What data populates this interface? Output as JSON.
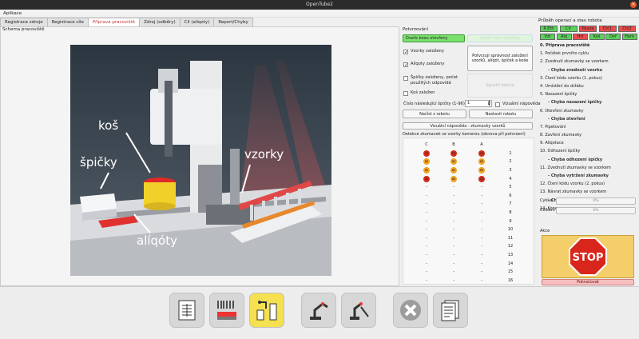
{
  "window": {
    "title": "OpenTube2"
  },
  "menu": {
    "items": [
      "Aplikace"
    ]
  },
  "tabs": [
    {
      "label": "Registrace zdroje",
      "active": false
    },
    {
      "label": "Registrace cíle",
      "active": false
    },
    {
      "label": "Příprava pracoviště",
      "active": true
    },
    {
      "label": "Zdroj (odběry)",
      "active": false
    },
    {
      "label": "Cíl (alíqoty)",
      "active": false
    },
    {
      "label": "Report/Chyby",
      "active": false
    }
  ],
  "scheme": {
    "title": "Schema pracoviště",
    "labels": {
      "kos": "koš",
      "spicky": "špičky",
      "vzorky": "vzorky",
      "aliqoty": "alíqóty"
    }
  },
  "confirm": {
    "title": "Potvrzování",
    "box_button": "Dveře boxu otevřeny",
    "box_status": "Dveře boxu zavřeny",
    "checks": [
      {
        "label": "Vzorky založeny",
        "checked": true
      },
      {
        "label": "Alíqoty založeny",
        "checked": true
      },
      {
        "label": "Špičky založeny, počet použitých odpovídá",
        "checked": false
      },
      {
        "label": "Koš založen",
        "checked": false
      }
    ],
    "confirm_button": "Potvrzuji správnost založení vzorků, alíqot, špiček a koše",
    "start_button": "Spustit robota",
    "next_tip_label": "Číslo následující špičky (1-96):",
    "next_tip_value": "1",
    "help_checkbox": "Vizuální nápověda",
    "load_button": "Načíst z robotu",
    "set_button": "Nastavit robotu",
    "visual_help_button": "Vizuální nápověda - zkumavky vzorků"
  },
  "detection": {
    "title": "Detekce zkumavek se vzorky kamerou (obnova při potvrzení)",
    "columns": [
      "C",
      "B",
      "A"
    ],
    "colors": {
      "red": "#d42a1a",
      "orange": "#f2a21b"
    },
    "rows": [
      {
        "n": "1",
        "cells": [
          {
            "c": "red",
            "t": "25"
          },
          {
            "c": "red",
            "t": "25"
          },
          {
            "c": "red",
            "t": "25"
          }
        ]
      },
      {
        "n": "2",
        "cells": [
          {
            "c": "orange",
            "t": "60"
          },
          {
            "c": "orange",
            "t": "60"
          },
          {
            "c": "orange",
            "t": "60"
          }
        ]
      },
      {
        "n": "3",
        "cells": [
          {
            "c": "orange",
            "t": "60"
          },
          {
            "c": "orange",
            "t": "60"
          },
          {
            "c": "orange",
            "t": "60"
          }
        ]
      },
      {
        "n": "4",
        "cells": [
          {
            "c": "red",
            "t": "25"
          },
          {
            "c": "orange",
            "t": "60"
          },
          {
            "c": "red",
            "t": "25"
          }
        ]
      },
      {
        "n": "5",
        "cells": [
          {
            "t": "-"
          },
          {
            "t": "-"
          },
          {
            "t": "-"
          }
        ]
      },
      {
        "n": "6",
        "cells": [
          {
            "t": "-"
          },
          {
            "t": "-"
          },
          {
            "t": "-"
          }
        ]
      },
      {
        "n": "7",
        "cells": [
          {
            "t": "-"
          },
          {
            "t": "-"
          },
          {
            "t": "-"
          }
        ]
      },
      {
        "n": "8",
        "cells": [
          {
            "t": "-"
          },
          {
            "t": "-"
          },
          {
            "t": "-"
          }
        ]
      },
      {
        "n": "9",
        "cells": [
          {
            "t": "-"
          },
          {
            "t": "-"
          },
          {
            "t": "-"
          }
        ]
      },
      {
        "n": "10",
        "cells": [
          {
            "t": "-"
          },
          {
            "t": "-"
          },
          {
            "t": "-"
          }
        ]
      },
      {
        "n": "11",
        "cells": [
          {
            "t": "-"
          },
          {
            "t": "-"
          },
          {
            "t": "-"
          }
        ]
      },
      {
        "n": "12",
        "cells": [
          {
            "t": "-"
          },
          {
            "t": "-"
          },
          {
            "t": "-"
          }
        ]
      },
      {
        "n": "13",
        "cells": [
          {
            "t": "-"
          },
          {
            "t": "-"
          },
          {
            "t": "-"
          }
        ]
      },
      {
        "n": "14",
        "cells": [
          {
            "t": "-"
          },
          {
            "t": "-"
          },
          {
            "t": "-"
          }
        ]
      },
      {
        "n": "15",
        "cells": [
          {
            "t": "-"
          },
          {
            "t": "-"
          },
          {
            "t": "-"
          }
        ]
      },
      {
        "n": "16",
        "cells": [
          {
            "t": "-"
          },
          {
            "t": "-"
          },
          {
            "t": "-"
          }
        ]
      }
    ]
  },
  "status": {
    "title": "Průběh operací a stav robota",
    "row1": [
      {
        "label": "R.Eth",
        "color": "#5ad25a"
      },
      {
        "label": "CV",
        "color": "#5ad25a"
      },
      {
        "label": "Pauza",
        "color": "#ee4b4b"
      },
      {
        "label": "Čtč1",
        "color": "#ee4b4b"
      },
      {
        "label": "Čtč2",
        "color": "#ee4b4b"
      }
    ],
    "row2": [
      {
        "label": "Vzt",
        "color": "#5ad25a"
      },
      {
        "label": "Alq",
        "color": "#5ad25a"
      },
      {
        "label": "Hrt",
        "color": "#ee4b4b"
      },
      {
        "label": "Koš",
        "color": "#5ad25a"
      },
      {
        "label": "Dvř",
        "color": "#5ad25a"
      },
      {
        "label": "Hom",
        "color": "#5ad25a"
      }
    ],
    "steps": [
      {
        "text": "0. Příprava pracoviště",
        "kind": "main"
      },
      {
        "text": "1. Počátek prvního cyklu",
        "kind": "step"
      },
      {
        "text": "2. Zvednutí zkumavky se vzorkem",
        "kind": "step"
      },
      {
        "text": "- Chyba zvednutí vzorku",
        "kind": "sub"
      },
      {
        "text": "3. Čtení kódu vzorku (1. pokus)",
        "kind": "step"
      },
      {
        "text": "4. Umístění do držáku",
        "kind": "step"
      },
      {
        "text": "5. Nasazení špičky",
        "kind": "step"
      },
      {
        "text": "- Chyba nasazení špičky",
        "kind": "sub"
      },
      {
        "text": "6. Otevření zkumavky",
        "kind": "step"
      },
      {
        "text": "- Chyba otevření",
        "kind": "sub"
      },
      {
        "text": "7. Pipetování",
        "kind": "step"
      },
      {
        "text": "8. Zavření zkumavky",
        "kind": "step"
      },
      {
        "text": "9. Alíqotace",
        "kind": "step"
      },
      {
        "text": "10. Odhození špičky",
        "kind": "step"
      },
      {
        "text": "- Chyba odhození špičky",
        "kind": "sub"
      },
      {
        "text": "11. Zvednutí zkumavky se vzorkem",
        "kind": "step"
      },
      {
        "text": "- Chyba vytržení zkumavky",
        "kind": "sub"
      },
      {
        "text": "12. Čtení kódu vzorku (2. pokus)",
        "kind": "step"
      },
      {
        "text": "13. Návrat zkumavky se vzorkem",
        "kind": "step"
      },
      {
        "text": "- Chyba nedostatku špiček",
        "kind": "sub"
      },
      {
        "text": "14. Konec operace",
        "kind": "step"
      }
    ],
    "cycle_label": "Cyklus",
    "cycle_progress": "0%",
    "total_label": "Celkem",
    "total_progress": "0%"
  },
  "actions": {
    "title": "Akce",
    "stop_label": "STOP",
    "continue_button": "Pokračovat"
  },
  "toolbar": [
    {
      "icon": "table-icon",
      "active": false
    },
    {
      "icon": "barcode-rack-icon",
      "active": false
    },
    {
      "icon": "workstation-prep-icon",
      "active": true
    },
    {
      "icon": "robot-arm-icon",
      "active": false
    },
    {
      "icon": "pipette-arm-icon",
      "active": false
    },
    {
      "icon": "close-x-icon",
      "active": false
    },
    {
      "icon": "report-icon",
      "active": false
    }
  ]
}
